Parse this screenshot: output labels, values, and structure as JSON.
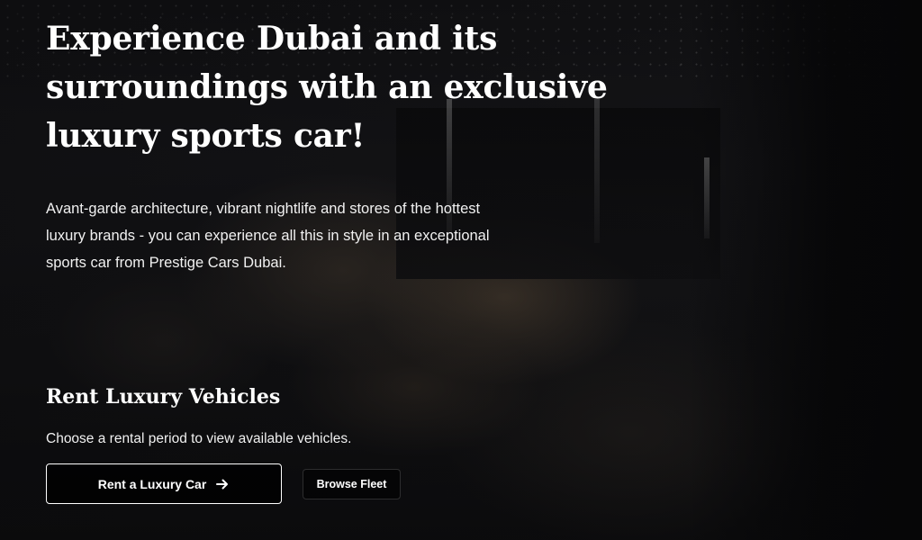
{
  "hero": {
    "headline": "Experience Dubai and its surroundings with an exclusive luxury sports car!",
    "lead": "Avant-garde architecture, vibrant nightlife and stores of the hottest luxury brands - you can experience all this in style in an exceptional sports car from Prestige Cars Dubai."
  },
  "rental": {
    "heading": "Rent Luxury Vehicles",
    "subtext": "Choose a rental period to view available vehicles.",
    "primary_button": {
      "label": "Rent a Luxury Car",
      "icon": "arrow-right-icon"
    },
    "secondary_button": {
      "label": "Browse Fleet"
    }
  },
  "colors": {
    "text": "#ffffff",
    "background": "#0b0b0c",
    "button_border": "#ffffff"
  }
}
